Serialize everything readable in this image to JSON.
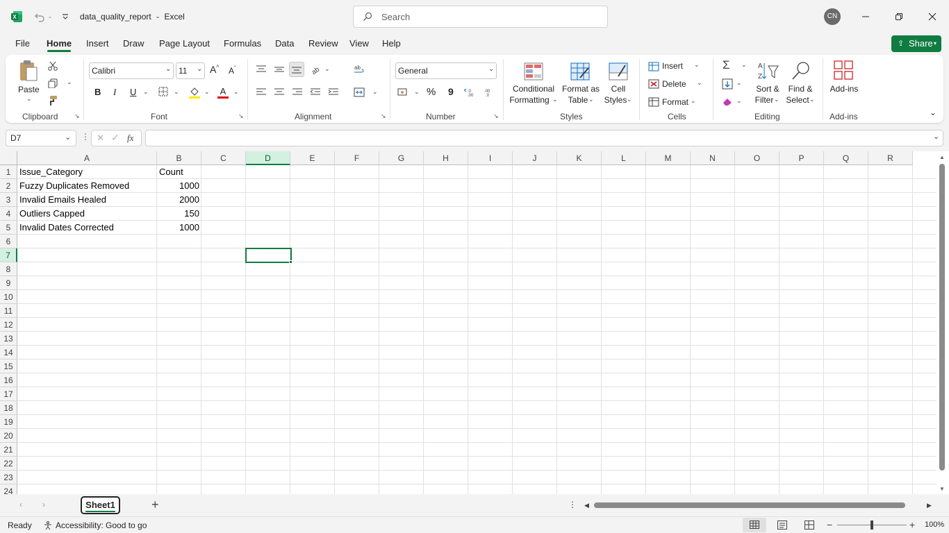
{
  "title": {
    "filename": "data_quality_report",
    "sep": "-",
    "app": "Excel",
    "search_placeholder": "Search",
    "avatar_initials": "CN"
  },
  "menu": {
    "tabs": [
      "File",
      "Home",
      "Insert",
      "Draw",
      "Page Layout",
      "Formulas",
      "Data",
      "Review",
      "View",
      "Help"
    ],
    "active": "Home",
    "share": "Share"
  },
  "ribbon": {
    "clipboard": {
      "paste": "Paste",
      "label": "Clipboard"
    },
    "font": {
      "name": "Calibri",
      "size": "11",
      "bold": "B",
      "italic": "I",
      "underline": "U",
      "label": "Font"
    },
    "alignment": {
      "label": "Alignment"
    },
    "number": {
      "format": "General",
      "percent": "%",
      "comma": "9",
      "label": "Number"
    },
    "styles": {
      "conditional1": "Conditional",
      "conditional2": "Formatting",
      "formatas1": "Format as",
      "formatas2": "Table",
      "cell1": "Cell",
      "cell2": "Styles",
      "label": "Styles"
    },
    "cells": {
      "insert": "Insert",
      "delete": "Delete",
      "format": "Format",
      "label": "Cells"
    },
    "editing": {
      "sort1": "Sort &",
      "sort2": "Filter",
      "find1": "Find &",
      "find2": "Select",
      "label": "Editing"
    },
    "addins": {
      "button": "Add-ins",
      "label": "Add-ins"
    }
  },
  "formula_bar": {
    "name_box": "D7",
    "fx": "fx",
    "formula": ""
  },
  "columns": [
    "A",
    "B",
    "C",
    "D",
    "E",
    "F",
    "G",
    "H",
    "I",
    "J",
    "K",
    "L",
    "M",
    "N",
    "O",
    "P",
    "Q",
    "R"
  ],
  "rows": [
    "1",
    "2",
    "3",
    "4",
    "5",
    "6",
    "7",
    "8",
    "9",
    "10",
    "11",
    "12",
    "13",
    "14",
    "15",
    "16",
    "17",
    "18",
    "19",
    "20",
    "21",
    "22",
    "23",
    "24"
  ],
  "cells": {
    "A1": "Issue_Category",
    "B1": "Count",
    "A2": "Fuzzy Duplicates Removed",
    "B2": "1000",
    "A3": "Invalid Emails Healed",
    "B3": "2000",
    "A4": "Outliers Capped",
    "B4": "150",
    "A5": "Invalid Dates Corrected",
    "B5": "1000"
  },
  "sheet_tabs": {
    "active": "Sheet1",
    "add": "+"
  },
  "status": {
    "ready": "Ready",
    "accessibility": "Accessibility: Good to go",
    "zoom": "100%"
  },
  "colors": {
    "accent_green": "#107c41",
    "selection": "#107c41"
  }
}
